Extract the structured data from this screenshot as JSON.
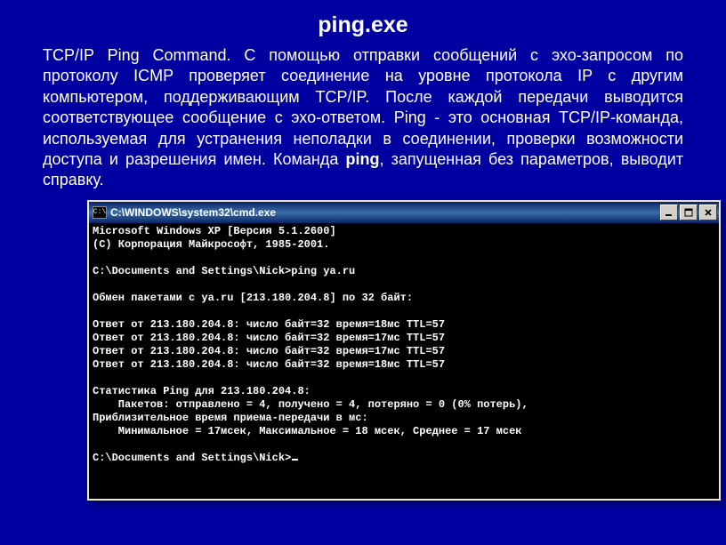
{
  "slide": {
    "title": "ping.exe",
    "description_pre": "TCP/IP Ping Command. С помощью отправки сообщений с эхо-запросом по протоколу ICMP проверяет соединение на уровне протокола IP с другим компьютером, поддерживающим TCP/IP. После каждой передачи выводится соответствующее сообщение с эхо-ответом. Ping - это основная TCP/IP-команда, используемая для устранения неполадки в соединении, проверки возможности доступа и разрешения имен. Команда ",
    "description_bold": "ping",
    "description_post": ", запущенная без параметров, выводит справку."
  },
  "cmd": {
    "icon_text": "C:\\",
    "title": "C:\\WINDOWS\\system32\\cmd.exe",
    "lines": [
      "Microsoft Windows XP [Версия 5.1.2600]",
      "(С) Корпорация Майкрософт, 1985-2001.",
      "",
      "C:\\Documents and Settings\\Nick>ping ya.ru",
      "",
      "Обмен пакетами с ya.ru [213.180.204.8] по 32 байт:",
      "",
      "Ответ от 213.180.204.8: число байт=32 время=18мс TTL=57",
      "Ответ от 213.180.204.8: число байт=32 время=17мс TTL=57",
      "Ответ от 213.180.204.8: число байт=32 время=17мс TTL=57",
      "Ответ от 213.180.204.8: число байт=32 время=18мс TTL=57",
      "",
      "Статистика Ping для 213.180.204.8:",
      "    Пакетов: отправлено = 4, получено = 4, потеряно = 0 (0% потерь),",
      "Приблизительное время приема-передачи в мс:",
      "    Минимальное = 17мсек, Максимальное = 18 мсек, Среднее = 17 мсек",
      "",
      "C:\\Documents and Settings\\Nick>"
    ]
  }
}
